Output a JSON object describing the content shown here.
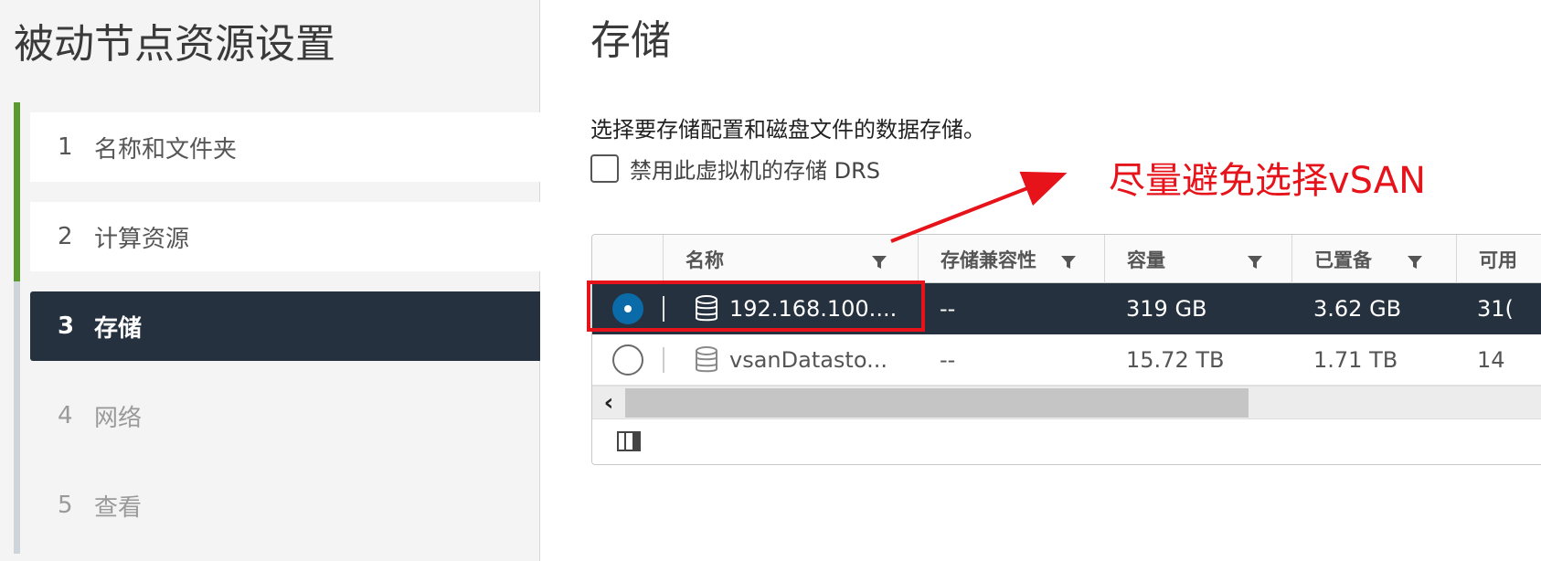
{
  "wizard": {
    "title": "被动节点资源设置",
    "steps": [
      {
        "num": "1",
        "label": "名称和文件夹",
        "state": "done"
      },
      {
        "num": "2",
        "label": "计算资源",
        "state": "done"
      },
      {
        "num": "3",
        "label": "存储",
        "state": "active"
      },
      {
        "num": "4",
        "label": "网络",
        "state": "pending"
      },
      {
        "num": "5",
        "label": "查看",
        "state": "pending"
      }
    ]
  },
  "main": {
    "title": "存储",
    "description": "选择要存储配置和磁盘文件的数据存储。",
    "disable_drs_label": "禁用此虚拟机的存储 DRS",
    "disable_drs_checked": false,
    "annotation": "尽量避免选择vSAN"
  },
  "grid": {
    "columns": [
      "名称",
      "存储兼容性",
      "容量",
      "已置备",
      "可用"
    ],
    "rows": [
      {
        "selected": true,
        "name": "192.168.100....",
        "compat": "--",
        "capacity": "319 GB",
        "provisioned": "3.62 GB",
        "free": "31("
      },
      {
        "selected": false,
        "name": "vsanDatasto...",
        "compat": "--",
        "capacity": "15.72 TB",
        "provisioned": "1.71 TB",
        "free": "14"
      }
    ],
    "scroll_left_glyph": "‹"
  },
  "colors": {
    "active_step_bg": "#25313e",
    "progress_green": "#5a9a2e",
    "annotation_red": "#e6131a",
    "radio_blue": "#0b6aa8"
  },
  "icons": {
    "filter": "filter-icon",
    "datastore": "database-icon",
    "column_toggle": "column-toggle-icon"
  }
}
